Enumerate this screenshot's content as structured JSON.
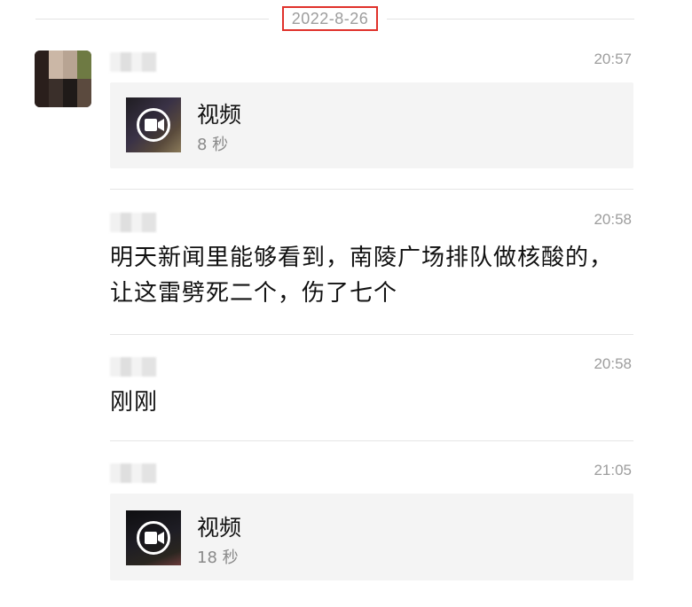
{
  "date_divider": "2022-8-26",
  "messages": [
    {
      "time": "20:57",
      "card": {
        "title": "视频",
        "duration": "8 秒"
      }
    },
    {
      "time": "20:58",
      "text": "明天新闻里能够看到，南陵广场排队做核酸的，让这雷劈死二个，伤了七个"
    },
    {
      "time": "20:58",
      "text": "刚刚"
    },
    {
      "time": "21:05",
      "card": {
        "title": "视频",
        "duration": "18 秒"
      }
    }
  ],
  "colors": {
    "highlight": "#e0312b",
    "meta_text": "#9d9d9d",
    "card_bg": "#f4f4f4"
  },
  "icons": {
    "video": "video-camera-icon"
  }
}
